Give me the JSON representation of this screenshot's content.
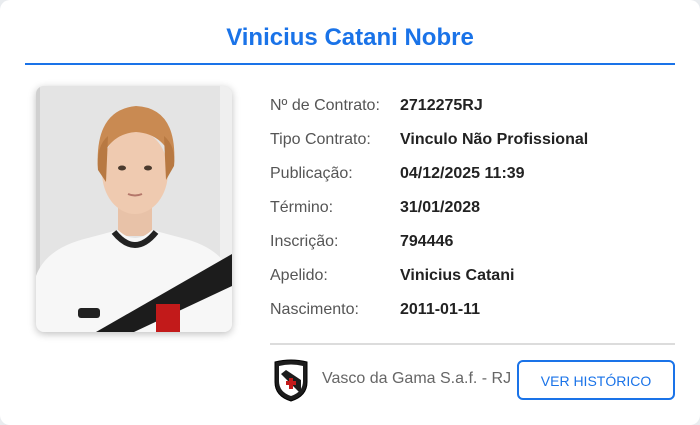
{
  "athlete": {
    "name": "Vinicius Catani Nobre"
  },
  "details": [
    {
      "label": "Nº de Contrato:",
      "value": "2712275RJ"
    },
    {
      "label": "Tipo Contrato:",
      "value": "Vinculo Não Profissional"
    },
    {
      "label": "Publicação:",
      "value": "04/12/2025 11:39"
    },
    {
      "label": "Término:",
      "value": "31/01/2028"
    },
    {
      "label": "Inscrição:",
      "value": "794446"
    },
    {
      "label": "Apelido:",
      "value": "Vinicius Catani"
    },
    {
      "label": "Nascimento:",
      "value": "2011-01-11"
    }
  ],
  "club": {
    "name": "Vasco da Gama S.a.f. - RJ",
    "crest_icon": "vasco-crest-icon"
  },
  "actions": {
    "history_label": "VER HISTÓRICO"
  },
  "colors": {
    "accent": "#1a73e8",
    "label": "#555555",
    "value": "#222222"
  }
}
